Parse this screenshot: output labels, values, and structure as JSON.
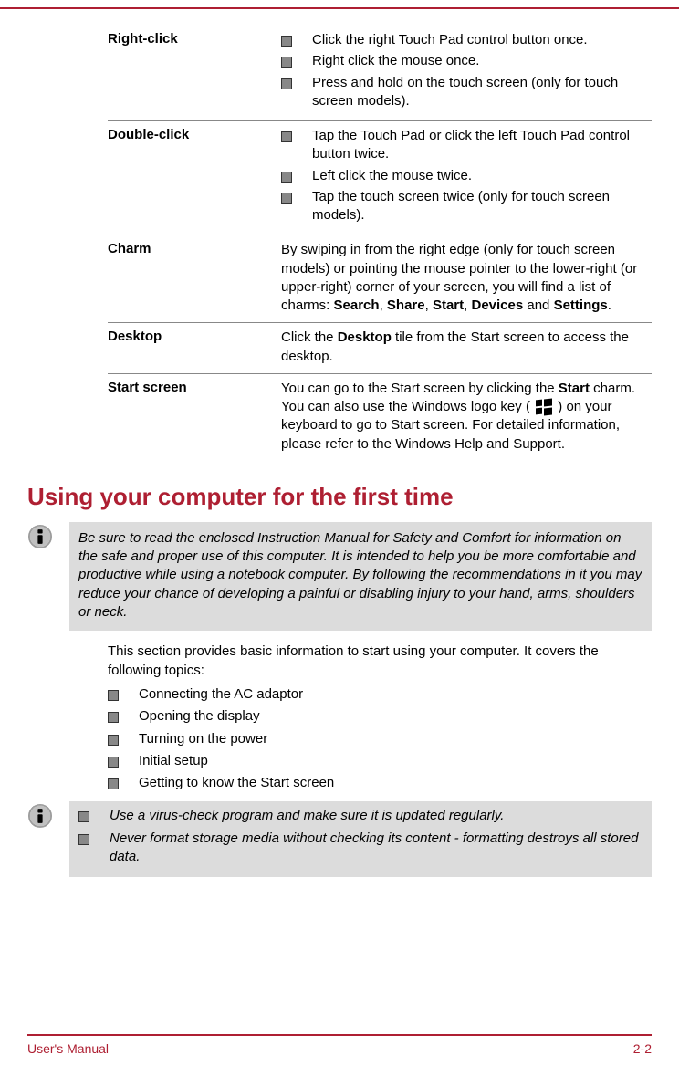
{
  "table": {
    "rows": [
      {
        "term": "Right-click",
        "type": "list",
        "items": [
          "Click the right Touch Pad control button once.",
          "Right click the mouse once.",
          "Press and hold on the touch screen (only for touch screen models)."
        ]
      },
      {
        "term": "Double-click",
        "type": "list",
        "items": [
          "Tap the Touch Pad or click the left Touch Pad control button twice.",
          "Left click the mouse twice.",
          "Tap the touch screen twice (only for touch screen models)."
        ]
      },
      {
        "term": "Charm",
        "type": "html",
        "html": "By swiping in from the right edge (only for touch screen models) or pointing the mouse pointer to the lower-right (or upper-right) corner of your screen, you will find a list of charms: <b>Search</b>, <b>Share</b>, <b>Start</b>, <b>Devices</b> and <b>Settings</b>."
      },
      {
        "term": "Desktop",
        "type": "html",
        "html": "Click the <b>Desktop</b> tile from the Start screen to access the desktop."
      },
      {
        "term": "Start screen",
        "type": "winkey",
        "pre": "You can go to the Start screen by clicking the <b>Start</b> charm. You can also use the Windows logo key ( ",
        "post": " ) on your keyboard to go to Start screen. For detailed information, please refer to the Windows Help and Support."
      }
    ]
  },
  "heading": "Using your computer for the first time",
  "note1": "Be sure to read the enclosed Instruction Manual for Safety and Comfort for information on the safe and proper use of this computer. It is intended to help you be more comfortable and productive while using a notebook computer. By following the recommendations in it you may reduce your chance of developing a painful or disabling injury to your hand, arms, shoulders or neck.",
  "intro": "This section provides basic information to start using your computer. It covers the following topics:",
  "topics": [
    "Connecting the AC adaptor",
    "Opening the display",
    "Turning on the power",
    "Initial setup",
    "Getting to know the Start screen"
  ],
  "note2_items": [
    "Use a virus-check program and make sure it is updated regularly.",
    "Never format storage media without checking its content - formatting destroys all stored data."
  ],
  "footer": {
    "left": "User's Manual",
    "right": "2-2"
  }
}
